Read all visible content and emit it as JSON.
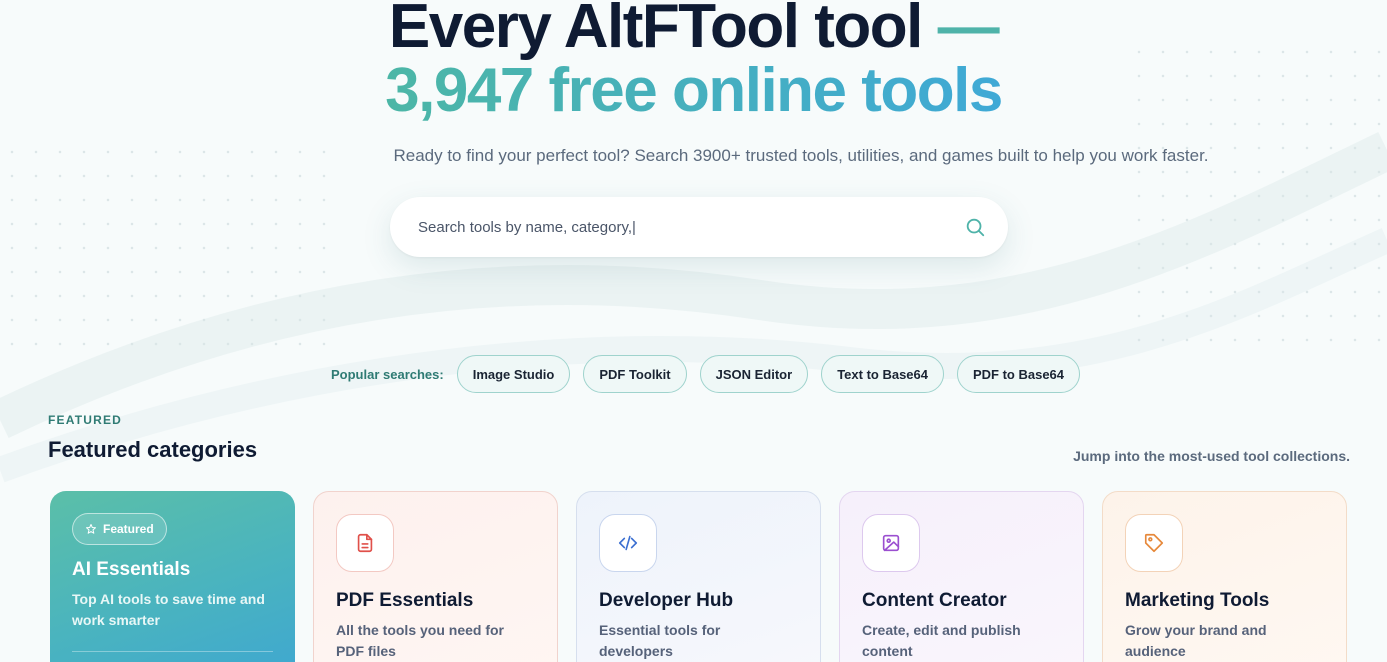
{
  "hero": {
    "title_main": "Every AltFTool tool",
    "title_dash": "—",
    "subtitle": "3,947 free online tools",
    "tagline": "Ready to find your perfect tool? Search 3900+ trusted tools, utilities, and games built to help you work faster."
  },
  "search": {
    "value": "Search tools by name, category,|",
    "icon": "search-icon"
  },
  "popular": {
    "label": "Popular searches:",
    "chips": [
      "Image Studio",
      "PDF Toolkit",
      "JSON Editor",
      "Text to Base64",
      "PDF to Base64"
    ]
  },
  "featured": {
    "eyebrow": "FEATURED",
    "title": "Featured categories",
    "hint": "Jump into the most-used tool collections.",
    "cards": [
      {
        "badge": "Featured",
        "title": "AI Essentials",
        "desc": "Top AI tools to save time and work smarter"
      },
      {
        "title": "PDF Essentials",
        "desc": "All the tools you need for PDF files",
        "icon": "document-icon",
        "color": "#e0504a"
      },
      {
        "title": "Developer Hub",
        "desc": "Essential tools for developers",
        "icon": "code-icon",
        "color": "#3b6fd1"
      },
      {
        "title": "Content Creator",
        "desc": "Create, edit and publish content",
        "icon": "image-icon",
        "color": "#9b4fd0"
      },
      {
        "title": "Marketing Tools",
        "desc": "Grow your brand and audience",
        "icon": "tag-icon",
        "color": "#e6883a"
      }
    ]
  },
  "colors": {
    "accent": "#4fb3a9",
    "gradient_start": "#4cb6a6",
    "gradient_end": "#3fa9d6",
    "heading": "#0f1b33"
  }
}
